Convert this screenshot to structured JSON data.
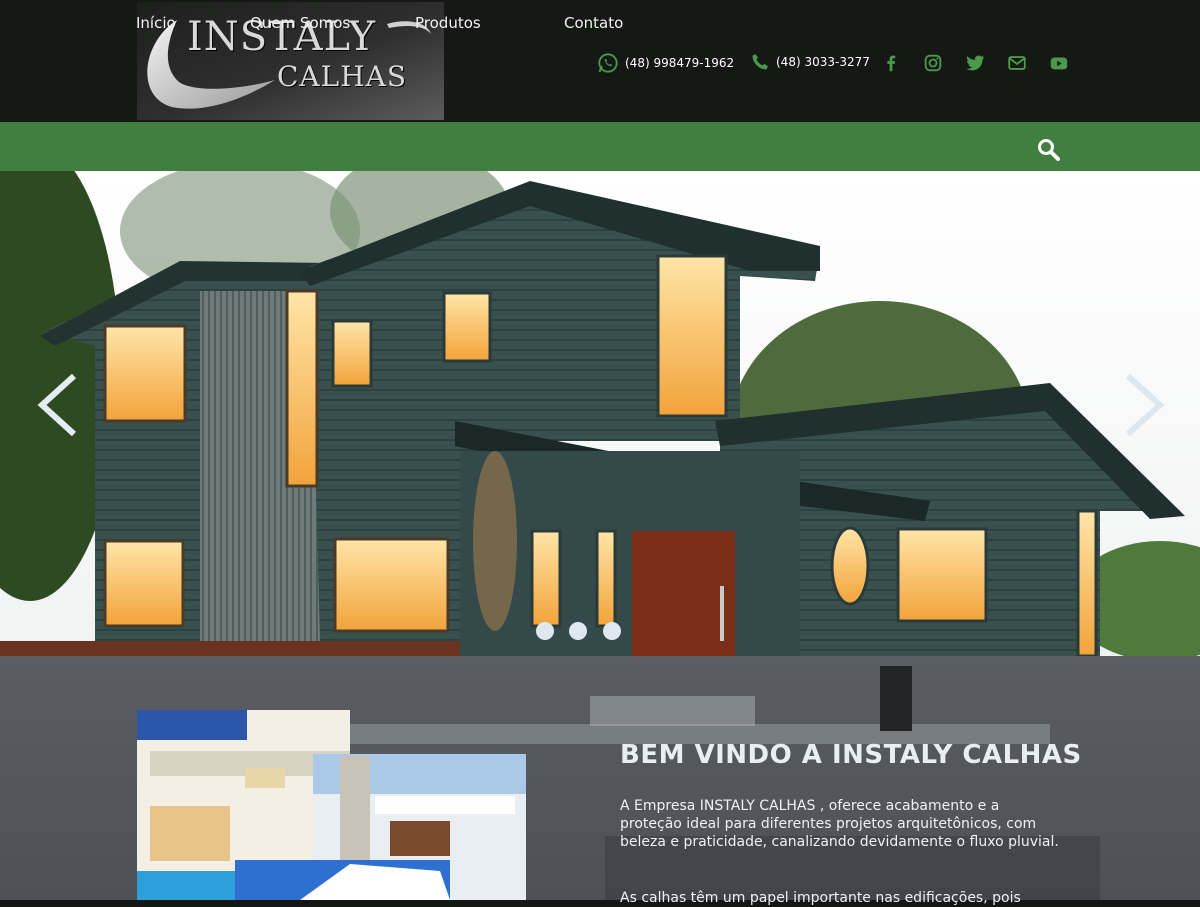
{
  "brand": {
    "line1": "INSTALY",
    "line2": "CALHAS"
  },
  "contacts": {
    "whatsapp": "(48) 998479-1962",
    "phone": "(48) 3033-3277"
  },
  "socials": [
    "facebook-icon",
    "instagram-icon",
    "twitter-icon",
    "mail-icon",
    "youtube-icon"
  ],
  "nav": {
    "items": [
      {
        "label": "Início"
      },
      {
        "label": "Quem Somos"
      },
      {
        "label": "Produtos"
      },
      {
        "label": "Contato"
      }
    ]
  },
  "slider": {
    "slide_count": 3,
    "active_index": 0
  },
  "welcome": {
    "title": "BEM VINDO A INSTALY CALHAS",
    "paragraph1": "A Empresa INSTALY CALHAS , oferece acabamento e a proteção ideal para diferentes projetos arquitetônicos, com beleza e praticidade, canalizando devidamente o fluxo pluvial.",
    "paragraph2": "As calhas têm um papel importante nas edificações, pois"
  },
  "colors": {
    "header_bg": "#161816",
    "nav_bg": "#417f41",
    "icon_green": "#4a8a4a",
    "text_light": "#f2f2f2"
  }
}
